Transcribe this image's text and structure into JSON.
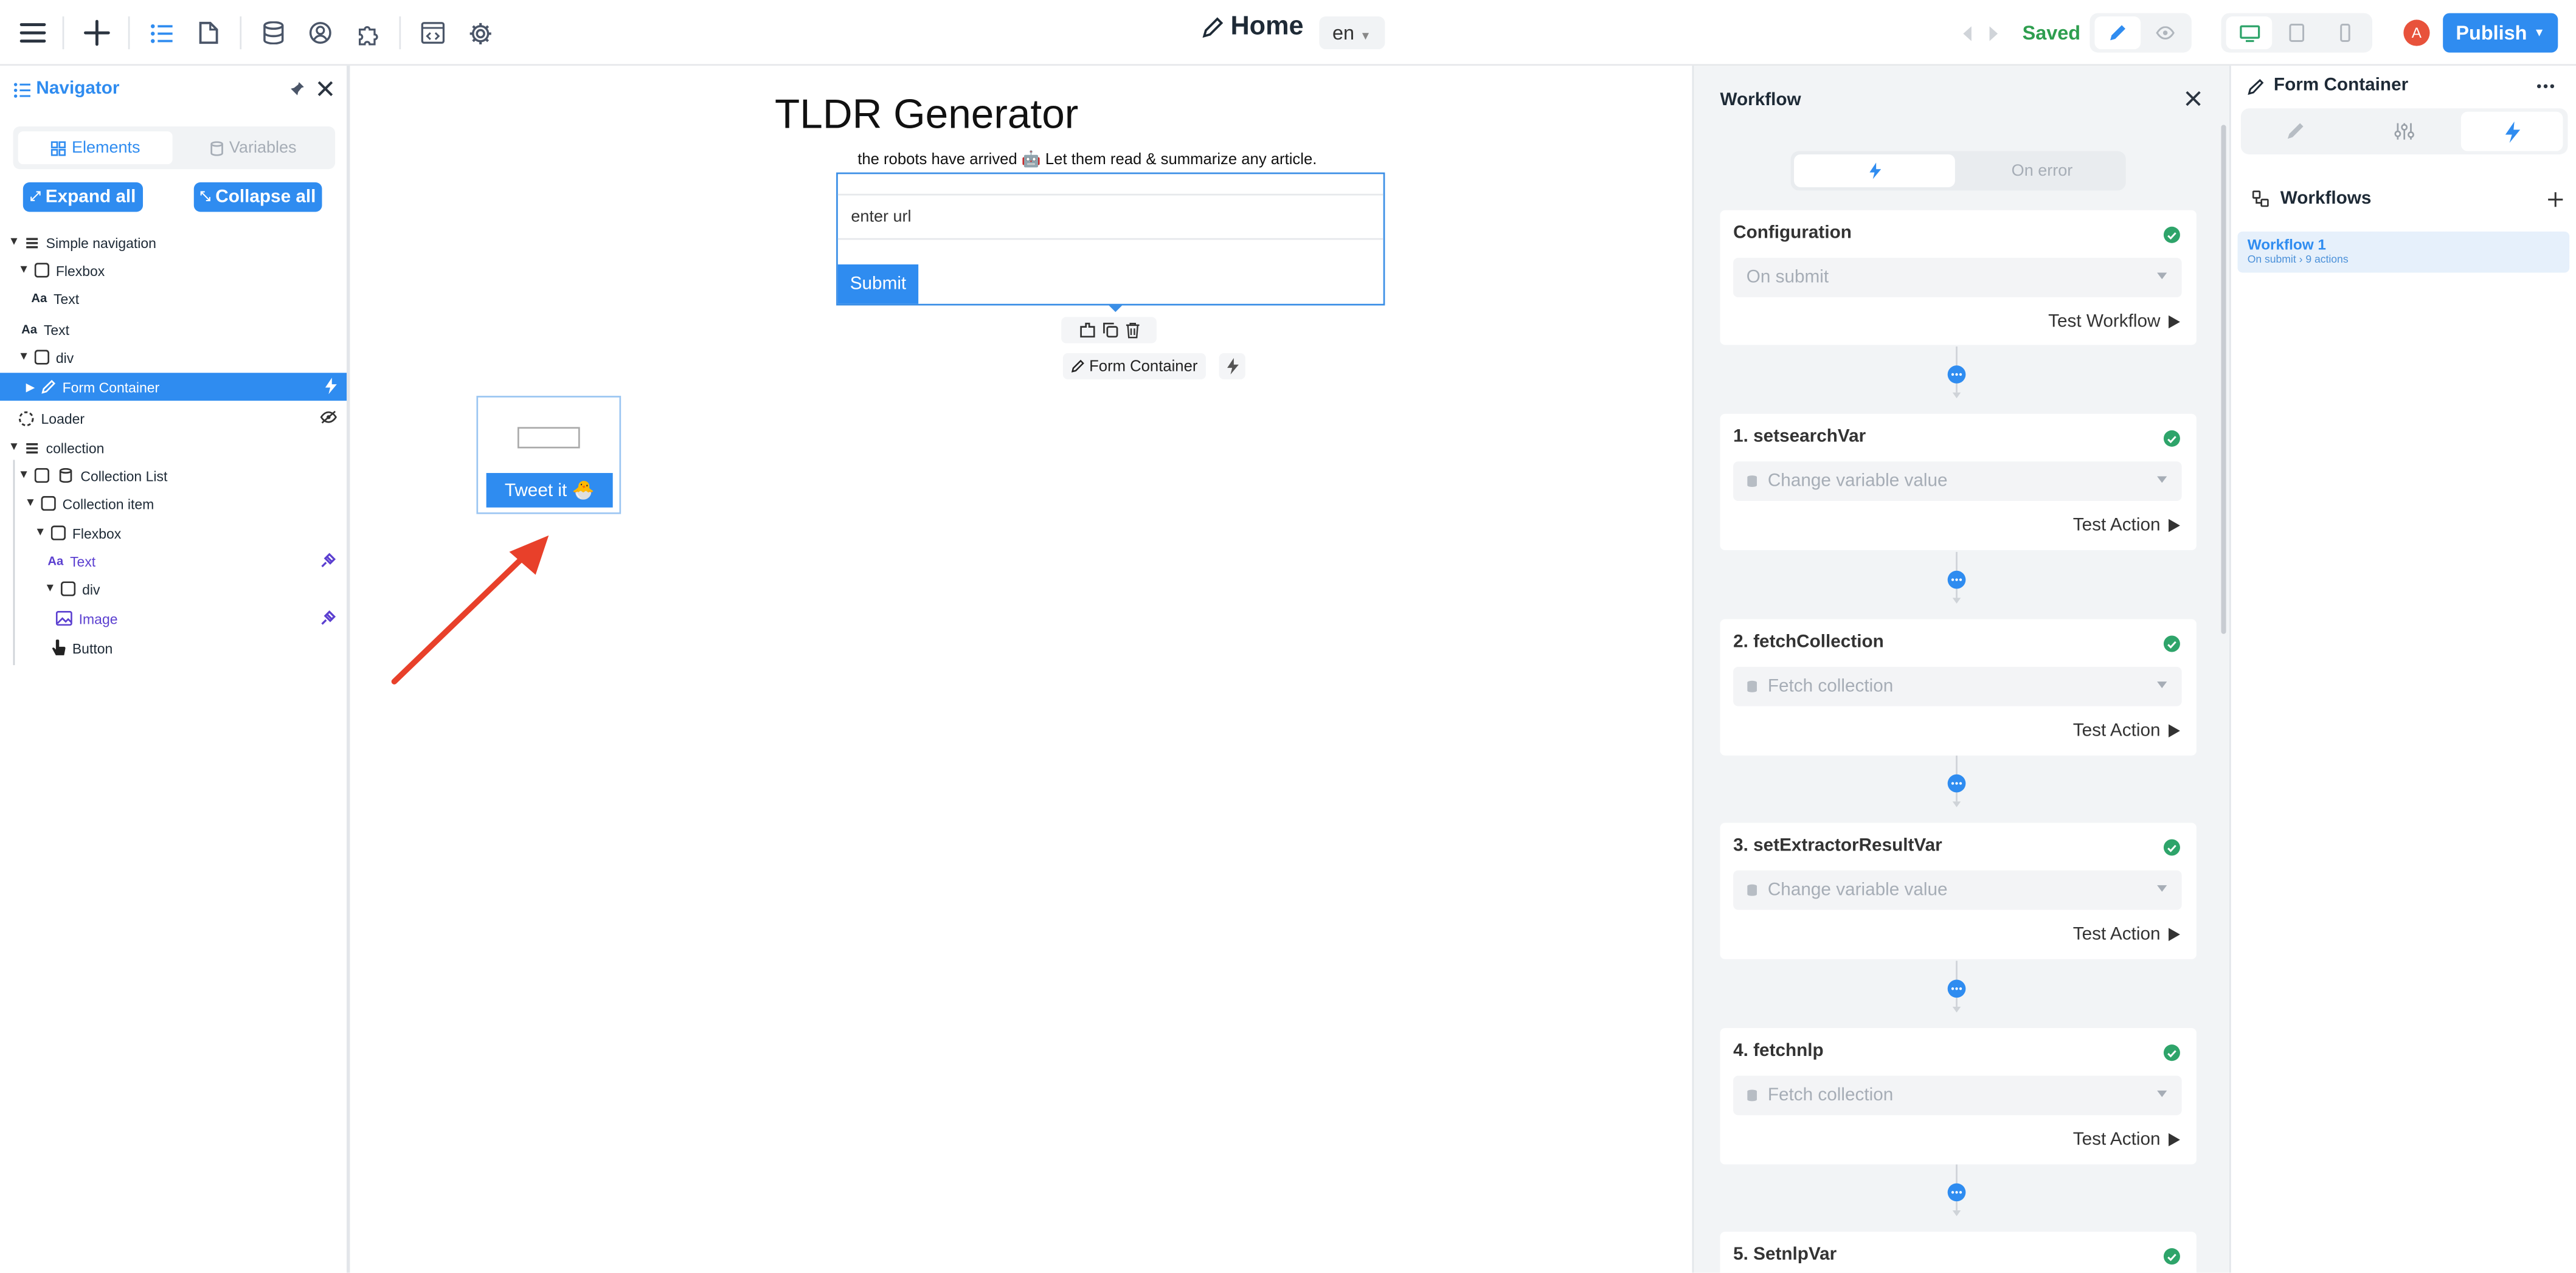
{
  "topbar": {
    "page_title": "Home",
    "language": "en",
    "status": "Saved",
    "publish_label": "Publish",
    "avatar_initial": "A",
    "icons": [
      "menu-icon",
      "add-icon",
      "navigator-icon",
      "pages-icon",
      "database-icon",
      "users-icon",
      "plugins-icon",
      "code-icon",
      "settings-icon",
      "pencil-icon",
      "undo-icon",
      "redo-icon",
      "edit-mode-icon",
      "preview-icon",
      "desktop-icon",
      "tablet-icon",
      "mobile-icon"
    ]
  },
  "navigator": {
    "title": "Navigator",
    "tabs": {
      "elements": "Elements",
      "variables": "Variables"
    },
    "expand_all": "Expand all",
    "collapse_all": "Collapse all",
    "tree": [
      {
        "label": "Simple navigation",
        "icon": "section-icon"
      },
      {
        "label": "Flexbox",
        "icon": "box-icon"
      },
      {
        "label": "Text",
        "icon": "text-icon"
      },
      {
        "label": "Text",
        "icon": "text-icon"
      },
      {
        "label": "div",
        "icon": "box-icon"
      },
      {
        "label": "Form Container",
        "icon": "pencil-icon",
        "selected": true
      },
      {
        "label": "Loader",
        "icon": "loader-icon"
      },
      {
        "label": "collection",
        "icon": "section-icon"
      },
      {
        "label": "Collection List",
        "icon": "database-icon"
      },
      {
        "label": "Collection item",
        "icon": "box-icon"
      },
      {
        "label": "Flexbox",
        "icon": "box-icon"
      },
      {
        "label": "Text",
        "icon": "text-icon",
        "bound": true
      },
      {
        "label": "div",
        "icon": "box-icon"
      },
      {
        "label": "Image",
        "icon": "image-icon",
        "bound": true
      },
      {
        "label": "Button",
        "icon": "button-icon"
      }
    ]
  },
  "canvas": {
    "title": "TLDR Generator",
    "subtitle": "the robots have arrived 🤖 Let them read & summarize any article.",
    "input_value": "enter url",
    "submit_label": "Submit",
    "selected_element_label": "Form Container",
    "tweet_label": "Tweet it 🐣"
  },
  "workflow": {
    "title": "Workflow",
    "tabs": {
      "on_error": "On error"
    },
    "config": {
      "title": "Configuration",
      "trigger": "On submit",
      "test_label": "Test Workflow"
    },
    "actions": [
      {
        "title": "1. setsearchVar",
        "type": "Change variable value",
        "test_label": "Test Action"
      },
      {
        "title": "2. fetchCollection",
        "type": "Fetch collection",
        "test_label": "Test Action"
      },
      {
        "title": "3. setExtractorResultVar",
        "type": "Change variable value",
        "test_label": "Test Action"
      },
      {
        "title": "4. fetchnlp",
        "type": "Fetch collection",
        "test_label": "Test Action"
      },
      {
        "title": "5. SetnlpVar"
      }
    ],
    "help_label": "?"
  },
  "right_panel": {
    "title": "Form Container",
    "section_title": "Workflows",
    "workflow_name": "Workflow 1",
    "workflow_meta": "On submit › 9 actions"
  },
  "colors": {
    "accent": "#2f8cf0",
    "success": "#2ea46a",
    "arrow": "#e8402a"
  }
}
